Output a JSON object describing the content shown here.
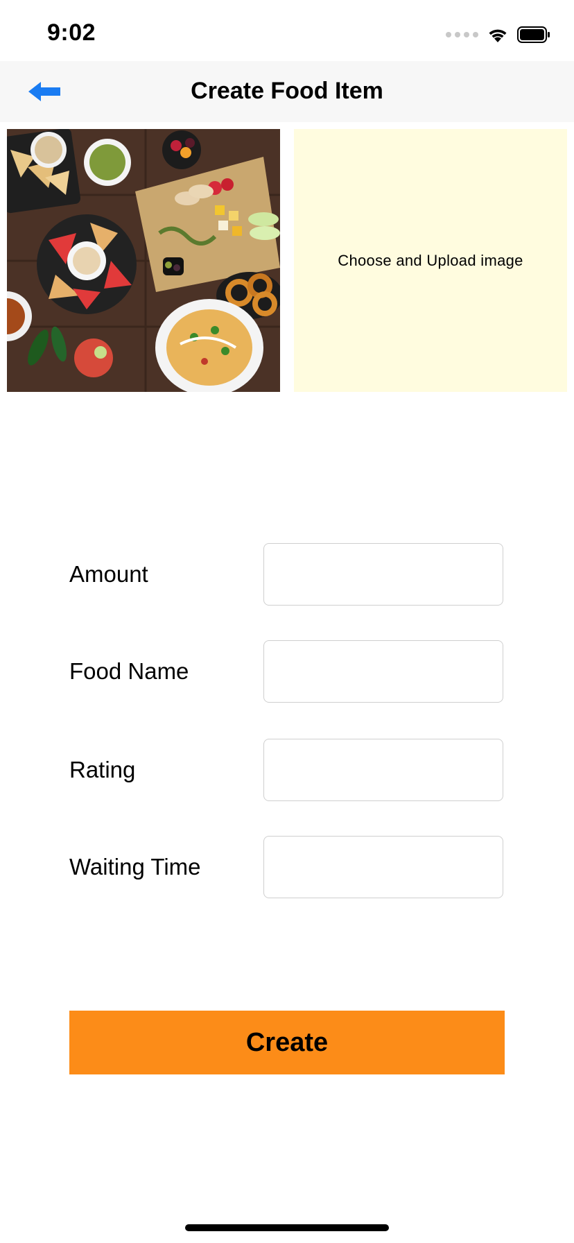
{
  "status_bar": {
    "time": "9:02",
    "icons": [
      "cellular-signal-icon",
      "wifi-icon",
      "battery-icon"
    ]
  },
  "nav": {
    "title": "Create Food Item",
    "back_icon": "back-arrow-icon",
    "accent_color": "#1a7cf2"
  },
  "images": {
    "photo_description": "food-platter-photo",
    "upload_label": "Choose and Upload image",
    "upload_bg_color": "#fffcdf"
  },
  "form": {
    "fields": [
      {
        "label": "Amount",
        "value": ""
      },
      {
        "label": "Food Name",
        "value": ""
      },
      {
        "label": "Rating",
        "value": ""
      },
      {
        "label": "Waiting Time",
        "value": ""
      }
    ]
  },
  "actions": {
    "create_label": "Create",
    "create_color": "#fc8c18"
  }
}
